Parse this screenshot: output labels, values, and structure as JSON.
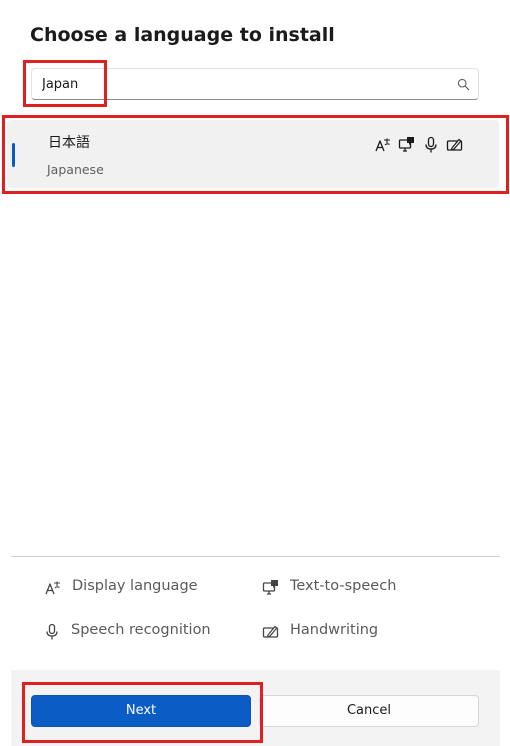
{
  "dialog": {
    "title": "Choose a language to install"
  },
  "search": {
    "value": "Japan",
    "icon": "search-icon"
  },
  "languages": [
    {
      "native_name": "日本語",
      "english_name": "Japanese",
      "selected": true,
      "features": [
        "display-language-icon",
        "text-to-speech-icon",
        "speech-recognition-icon",
        "handwriting-icon"
      ]
    }
  ],
  "legend": {
    "display_language": "Display language",
    "text_to_speech": "Text-to-speech",
    "speech_recognition": "Speech recognition",
    "handwriting": "Handwriting"
  },
  "footer": {
    "next_label": "Next",
    "cancel_label": "Cancel"
  },
  "colors": {
    "accent": "#0b5cc4",
    "annotation": "#e0201e"
  }
}
